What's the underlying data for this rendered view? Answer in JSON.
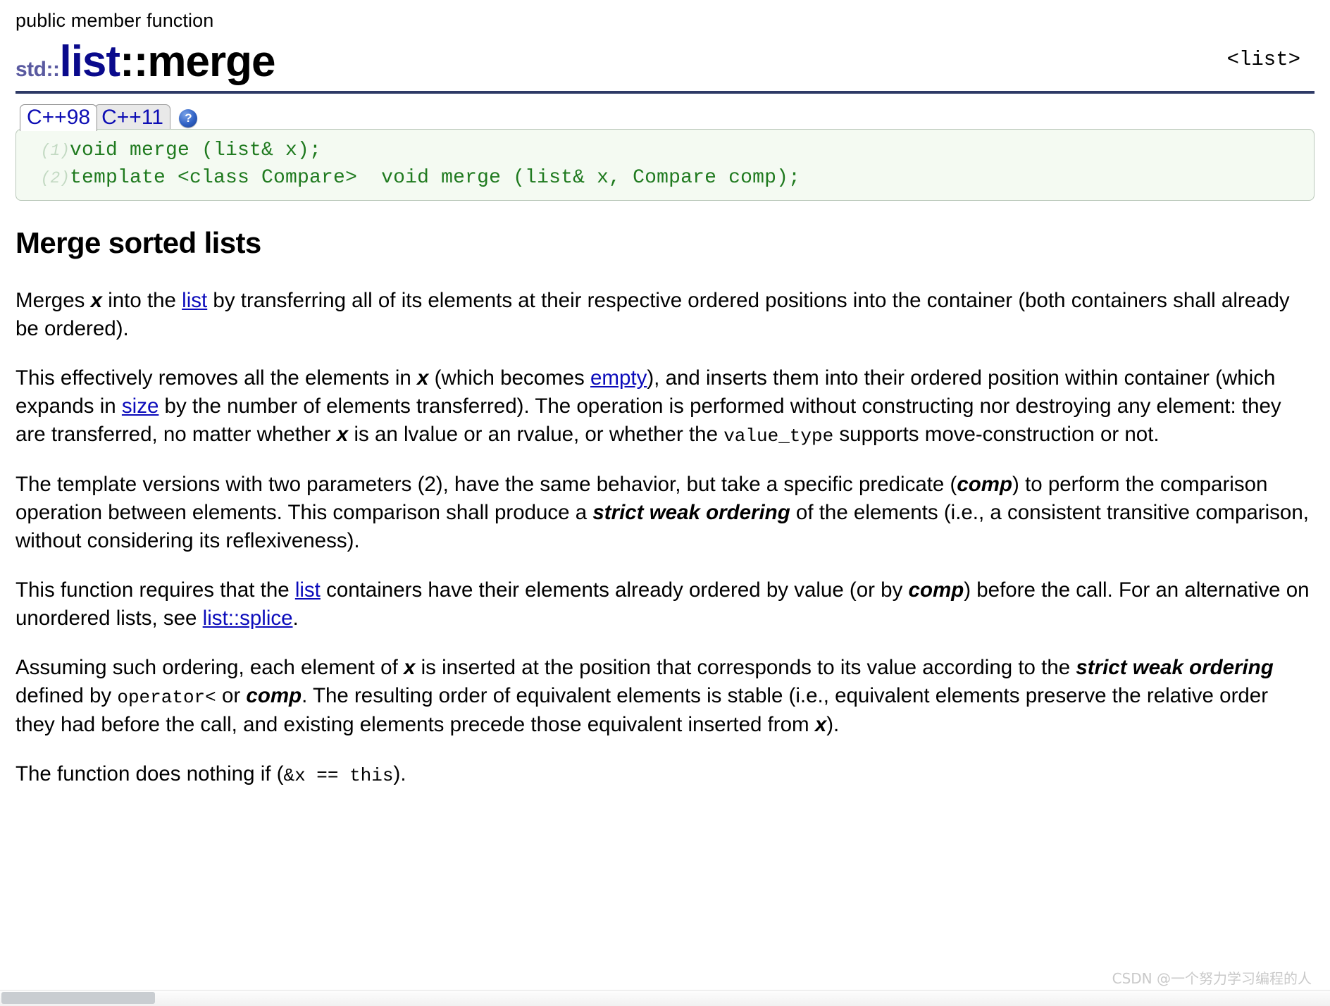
{
  "header": {
    "kind": "public member function",
    "namespace": "std::",
    "class": "list",
    "separator": "::",
    "function": "merge",
    "include": "<list>",
    "rule_color": "#2e3a66",
    "class_color": "#0a0a8c",
    "namespace_color": "#5a5aa0"
  },
  "tabs": {
    "items": [
      {
        "label": "C++98",
        "active": true
      },
      {
        "label": "C++11",
        "active": false
      }
    ],
    "help_icon": "help-question-icon",
    "help_glyph": "?"
  },
  "prototypes": {
    "rows": [
      {
        "num": "(1)",
        "signature": "void merge (list& x);"
      },
      {
        "num": "(2)",
        "signature": "template <class Compare>  void merge (list& x, Compare comp);"
      }
    ],
    "background": "#f4faf2",
    "text_color": "#1f7a1f"
  },
  "body": {
    "section_title": "Merge sorted lists",
    "paragraphs": [
      {
        "id": "p1",
        "parts": [
          {
            "t": "Merges ",
            "s": "plain"
          },
          {
            "t": "x",
            "s": "bold-italic"
          },
          {
            "t": " into the ",
            "s": "plain"
          },
          {
            "t": "list",
            "s": "link"
          },
          {
            "t": " by transferring all of its elements at their respective ordered positions into the container (both containers shall already be ordered).",
            "s": "plain"
          }
        ]
      },
      {
        "id": "p2",
        "parts": [
          {
            "t": "This effectively removes all the elements in ",
            "s": "plain"
          },
          {
            "t": "x",
            "s": "bold-italic"
          },
          {
            "t": " (which becomes ",
            "s": "plain"
          },
          {
            "t": "empty",
            "s": "link"
          },
          {
            "t": "), and inserts them into their ordered position within container (which expands in ",
            "s": "plain"
          },
          {
            "t": "size",
            "s": "link"
          },
          {
            "t": " by the number of elements transferred). The operation is performed without constructing nor destroying any element: they are transferred, no matter whether ",
            "s": "plain"
          },
          {
            "t": "x",
            "s": "bold-italic"
          },
          {
            "t": " is an lvalue or an rvalue, or whether the ",
            "s": "plain"
          },
          {
            "t": "value_type",
            "s": "code"
          },
          {
            "t": " supports move-construction or not.",
            "s": "plain"
          }
        ]
      },
      {
        "id": "p3",
        "parts": [
          {
            "t": "The template versions with two parameters (2), have the same behavior, but take a specific predicate (",
            "s": "plain"
          },
          {
            "t": "comp",
            "s": "bold-italic"
          },
          {
            "t": ") to perform the comparison operation between elements. This comparison shall produce a ",
            "s": "plain"
          },
          {
            "t": "strict weak ordering",
            "s": "bold-italic"
          },
          {
            "t": " of the elements (i.e., a consistent transitive comparison, without considering its reflexiveness).",
            "s": "plain"
          }
        ]
      },
      {
        "id": "p4",
        "parts": [
          {
            "t": "This function requires that the ",
            "s": "plain"
          },
          {
            "t": "list",
            "s": "link"
          },
          {
            "t": " containers have their elements already ordered by value (or by ",
            "s": "plain"
          },
          {
            "t": "comp",
            "s": "bold-italic"
          },
          {
            "t": ") before the call. For an alternative on unordered lists, see ",
            "s": "plain"
          },
          {
            "t": "list::splice",
            "s": "link"
          },
          {
            "t": ".",
            "s": "plain"
          }
        ]
      },
      {
        "id": "p5",
        "parts": [
          {
            "t": "Assuming such ordering, each element of ",
            "s": "plain"
          },
          {
            "t": "x",
            "s": "bold-italic"
          },
          {
            "t": " is inserted at the position that corresponds to its value according to the ",
            "s": "plain"
          },
          {
            "t": "strict weak ordering",
            "s": "bold-italic"
          },
          {
            "t": " defined by ",
            "s": "plain"
          },
          {
            "t": "operator<",
            "s": "code"
          },
          {
            "t": " or ",
            "s": "plain"
          },
          {
            "t": "comp",
            "s": "bold-italic"
          },
          {
            "t": ". The resulting order of equivalent elements is stable (i.e., equivalent elements preserve the relative order they had before the call, and existing elements precede those equivalent inserted from ",
            "s": "plain"
          },
          {
            "t": "x",
            "s": "bold-italic"
          },
          {
            "t": ").",
            "s": "plain"
          }
        ]
      },
      {
        "id": "p6",
        "parts": [
          {
            "t": "The function does nothing if (",
            "s": "plain"
          },
          {
            "t": "&x == this",
            "s": "code"
          },
          {
            "t": ").",
            "s": "plain"
          }
        ]
      }
    ]
  },
  "scrollbar": {
    "orientation": "horizontal",
    "thumb_position_percent": 0
  },
  "watermark": {
    "text": "CSDN @一个努力学习编程的人"
  }
}
